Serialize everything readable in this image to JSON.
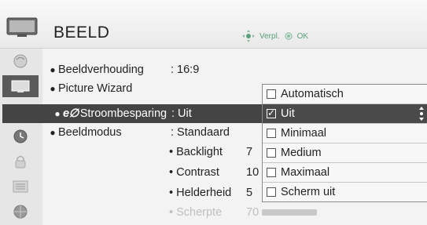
{
  "header": {
    "title": "BEELD",
    "hint_move": "Verpl.",
    "hint_ok": "OK"
  },
  "rail": {
    "icons": [
      "picture-icon",
      "tv-icon",
      "audio-icon",
      "clock-icon",
      "lock-icon",
      "options-icon",
      "network-icon"
    ],
    "active_index": 1
  },
  "settings": {
    "aspect_label": "Beeldverhouding",
    "aspect_value": ": 16:9",
    "wizard_label": "Picture Wizard",
    "eco_logo": "e∅",
    "energy_label": "Stroombesparing",
    "energy_value": ": Uit",
    "mode_label": "Beeldmodus",
    "mode_value": ": Standaard",
    "backlight_label": "• Backlight",
    "backlight_value": "7",
    "contrast_label": "• Contrast",
    "contrast_value": "10",
    "brightness_label": "• Helderheid",
    "brightness_value": "5",
    "sharpness_label": "• Scherpte",
    "sharpness_value": "70"
  },
  "dropdown": {
    "options": [
      "Automatisch",
      "Uit",
      "Minimaal",
      "Medium",
      "Maximaal",
      "Scherm uit"
    ],
    "selected_index": 1
  },
  "colors": {
    "selection": "#444444",
    "hint_green": "#5aa07a"
  }
}
